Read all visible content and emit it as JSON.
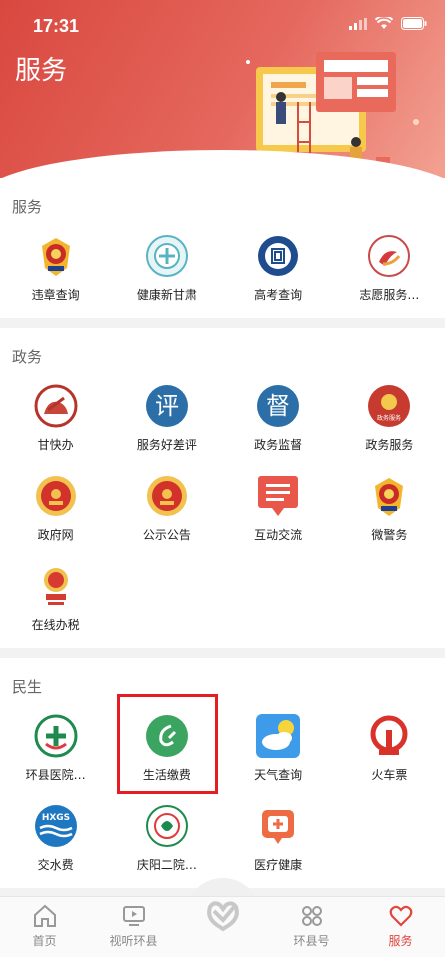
{
  "status_bar": {
    "time": "17:31"
  },
  "header": {
    "title": "服务"
  },
  "sections": [
    {
      "title": "服务",
      "items": [
        {
          "label": "违章查询",
          "icon": "police-badge-icon"
        },
        {
          "label": "健康新甘肃",
          "icon": "health-emblem-icon"
        },
        {
          "label": "高考查询",
          "icon": "exam-emblem-icon"
        },
        {
          "label": "志愿服务…",
          "icon": "volunteer-icon"
        }
      ]
    },
    {
      "title": "政务",
      "items": [
        {
          "label": "甘快办",
          "icon": "gan-kuai-ban-icon"
        },
        {
          "label": "服务好差评",
          "icon": "review-ping-icon"
        },
        {
          "label": "政务监督",
          "icon": "supervise-du-icon"
        },
        {
          "label": "政务服务",
          "icon": "gov-service-icon"
        },
        {
          "label": "政府网",
          "icon": "national-emblem-icon"
        },
        {
          "label": "公示公告",
          "icon": "national-emblem-icon"
        },
        {
          "label": "互动交流",
          "icon": "message-icon"
        },
        {
          "label": "微警务",
          "icon": "police-badge-icon"
        },
        {
          "label": "在线办税",
          "icon": "tax-emblem-icon"
        }
      ]
    },
    {
      "title": "民生",
      "items": [
        {
          "label": "环县医院…",
          "icon": "hospital-icon"
        },
        {
          "label": "生活缴费",
          "icon": "payment-icon"
        },
        {
          "label": "天气查询",
          "icon": "weather-icon"
        },
        {
          "label": "火车票",
          "icon": "railway-icon"
        },
        {
          "label": "交水费",
          "icon": "water-fee-icon"
        },
        {
          "label": "庆阳二院…",
          "icon": "hospital-icon"
        },
        {
          "label": "医疗健康",
          "icon": "medical-icon"
        }
      ]
    }
  ],
  "icon_text": {
    "ping": "评",
    "du": "督",
    "hxgs": "HXGS",
    "gov_service": "政务服务"
  },
  "tabs": [
    {
      "label": "首页",
      "icon": "home-icon",
      "active": false
    },
    {
      "label": "视听环县",
      "icon": "tv-icon",
      "active": false
    },
    {
      "label": "",
      "icon": "heart-hands-icon",
      "active": false
    },
    {
      "label": "环县号",
      "icon": "grid-icon",
      "active": false
    },
    {
      "label": "服务",
      "icon": "heart-icon",
      "active": true
    }
  ],
  "colors": {
    "header": "#d9483f",
    "accent": "#e0463c",
    "highlight_box": "#e51c23"
  }
}
